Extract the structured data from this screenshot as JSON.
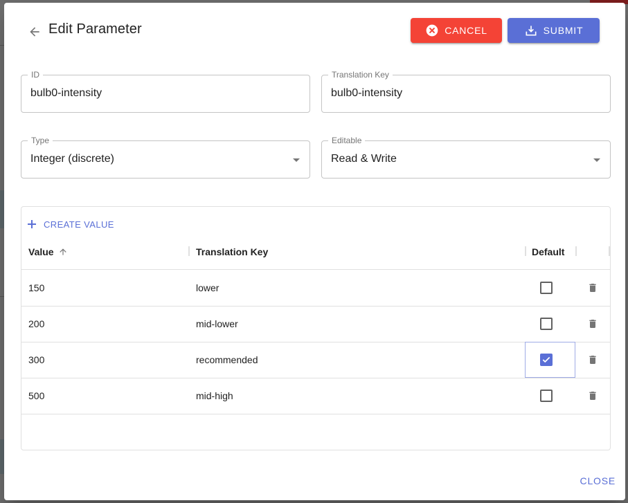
{
  "dialog": {
    "title": "Edit Parameter",
    "cancel_label": "CANCEL",
    "submit_label": "SUBMIT",
    "close_label": "CLOSE"
  },
  "fields": {
    "id": {
      "label": "ID",
      "value": "bulb0-intensity"
    },
    "translation_key": {
      "label": "Translation Key",
      "value": "bulb0-intensity"
    },
    "type": {
      "label": "Type",
      "value": "Integer (discrete)"
    },
    "editable": {
      "label": "Editable",
      "value": "Read & Write"
    }
  },
  "table": {
    "create_label": "CREATE VALUE",
    "columns": {
      "value": "Value",
      "translation_key": "Translation Key",
      "default": "Default"
    },
    "sort": {
      "column": "value",
      "direction": "ascending"
    },
    "rows": [
      {
        "value": "150",
        "translation_key": "lower",
        "default": false
      },
      {
        "value": "200",
        "translation_key": "mid-lower",
        "default": false
      },
      {
        "value": "300",
        "translation_key": "recommended",
        "default": true
      },
      {
        "value": "500",
        "translation_key": "mid-high",
        "default": false
      }
    ]
  },
  "colors": {
    "primary": "#5a6fd6",
    "danger": "#f44336"
  }
}
